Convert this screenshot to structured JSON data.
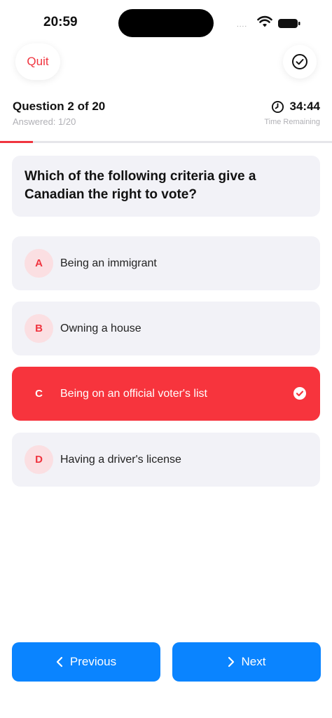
{
  "status_bar": {
    "time": "20:59",
    "signal": "....",
    "icons": [
      "wifi-icon",
      "battery-icon"
    ]
  },
  "header": {
    "quit_label": "Quit",
    "submit_icon": "check-circle-icon"
  },
  "progress": {
    "title": "Question 2 of 20",
    "answered": "Answered: 1/20",
    "timer": "34:44",
    "timer_label": "Time Remaining",
    "fraction": 0.1
  },
  "question": {
    "text": "Which of the following criteria give a Canadian the right to vote?"
  },
  "options": [
    {
      "letter": "A",
      "text": "Being an immigrant",
      "selected": false
    },
    {
      "letter": "B",
      "text": "Owning a house",
      "selected": false
    },
    {
      "letter": "C",
      "text": "Being on an official voter's list",
      "selected": true
    },
    {
      "letter": "D",
      "text": "Having a driver's license",
      "selected": false
    }
  ],
  "nav": {
    "prev_label": "Previous",
    "next_label": "Next",
    "prev_icon": "chevron-left-icon",
    "next_icon": "chevron-right-icon"
  },
  "colors": {
    "accent_red": "#f7343d",
    "primary_blue": "#0a84ff",
    "card_bg": "#f2f2f7"
  }
}
